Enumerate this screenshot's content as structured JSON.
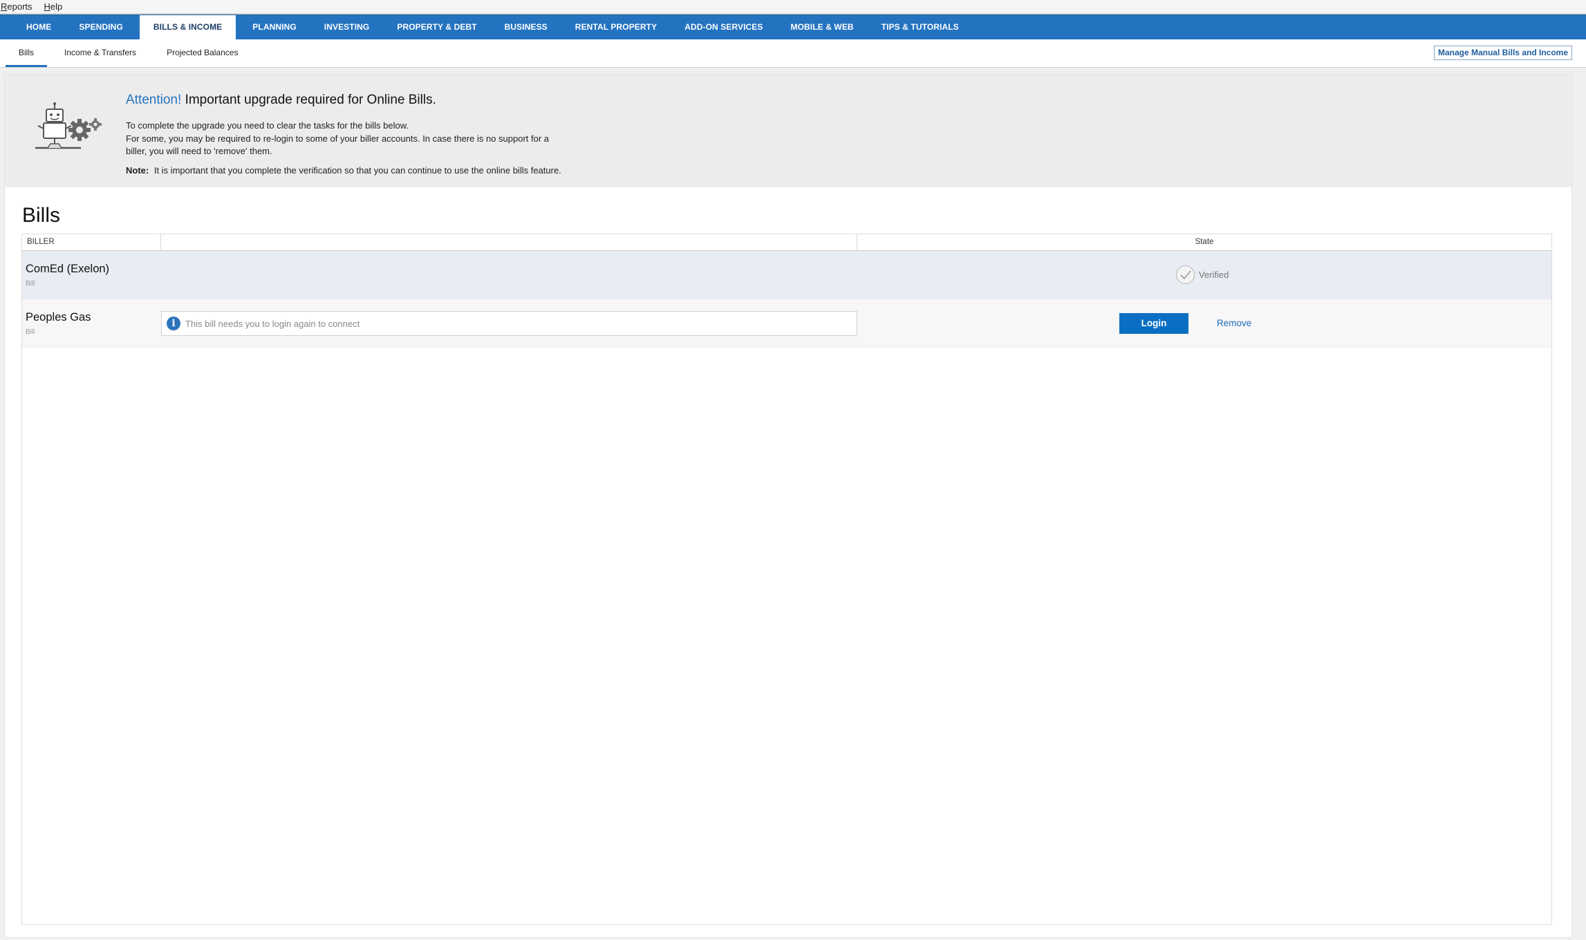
{
  "menubar": {
    "items": [
      "Reports",
      "Help"
    ]
  },
  "mainnav": {
    "tabs": [
      {
        "label": "HOME"
      },
      {
        "label": "SPENDING"
      },
      {
        "label": "BILLS & INCOME",
        "active": true
      },
      {
        "label": "PLANNING"
      },
      {
        "label": "INVESTING"
      },
      {
        "label": "PROPERTY & DEBT"
      },
      {
        "label": "BUSINESS"
      },
      {
        "label": "RENTAL PROPERTY"
      },
      {
        "label": "ADD-ON SERVICES"
      },
      {
        "label": "MOBILE & WEB"
      },
      {
        "label": "TIPS & TUTORIALS"
      }
    ]
  },
  "subnav": {
    "tabs": [
      {
        "label": "Bills",
        "active": true
      },
      {
        "label": "Income & Transfers"
      },
      {
        "label": "Projected Balances"
      }
    ],
    "manage_button": "Manage Manual Bills and Income"
  },
  "banner": {
    "attention": "Attention!",
    "title": "Important upgrade required for Online Bills.",
    "line1": "To complete the upgrade you need to clear the tasks for the bills below.",
    "line2": "For some, you may be required to re-login to some of your biller accounts. In case there is no support for a",
    "line3": "biller, you will need to 'remove' them.",
    "note_label": "Note:",
    "note_text": "It is important that you complete the verification so that you can continue to use the online bills feature."
  },
  "bills": {
    "title": "Bills",
    "headers": {
      "biller": "BILLER",
      "middle": "",
      "state": "State"
    },
    "rows": [
      {
        "name": "ComEd (Exelon)",
        "type": "Bill",
        "state": "Verified"
      },
      {
        "name": "Peoples Gas",
        "type": "Bill",
        "notice": "This bill needs you to login again to connect",
        "login_label": "Login",
        "remove_label": "Remove"
      }
    ]
  },
  "colors": {
    "nav_blue": "#2473c0",
    "button_blue": "#0a6fc2",
    "link_blue": "#1f6fb9",
    "banner_bg": "#ececec",
    "verified_row_bg": "#e8ecf3"
  },
  "icons": {
    "banner": "robot-gears-icon",
    "verified": "checkmark-circle-icon",
    "notice": "info-icon"
  }
}
